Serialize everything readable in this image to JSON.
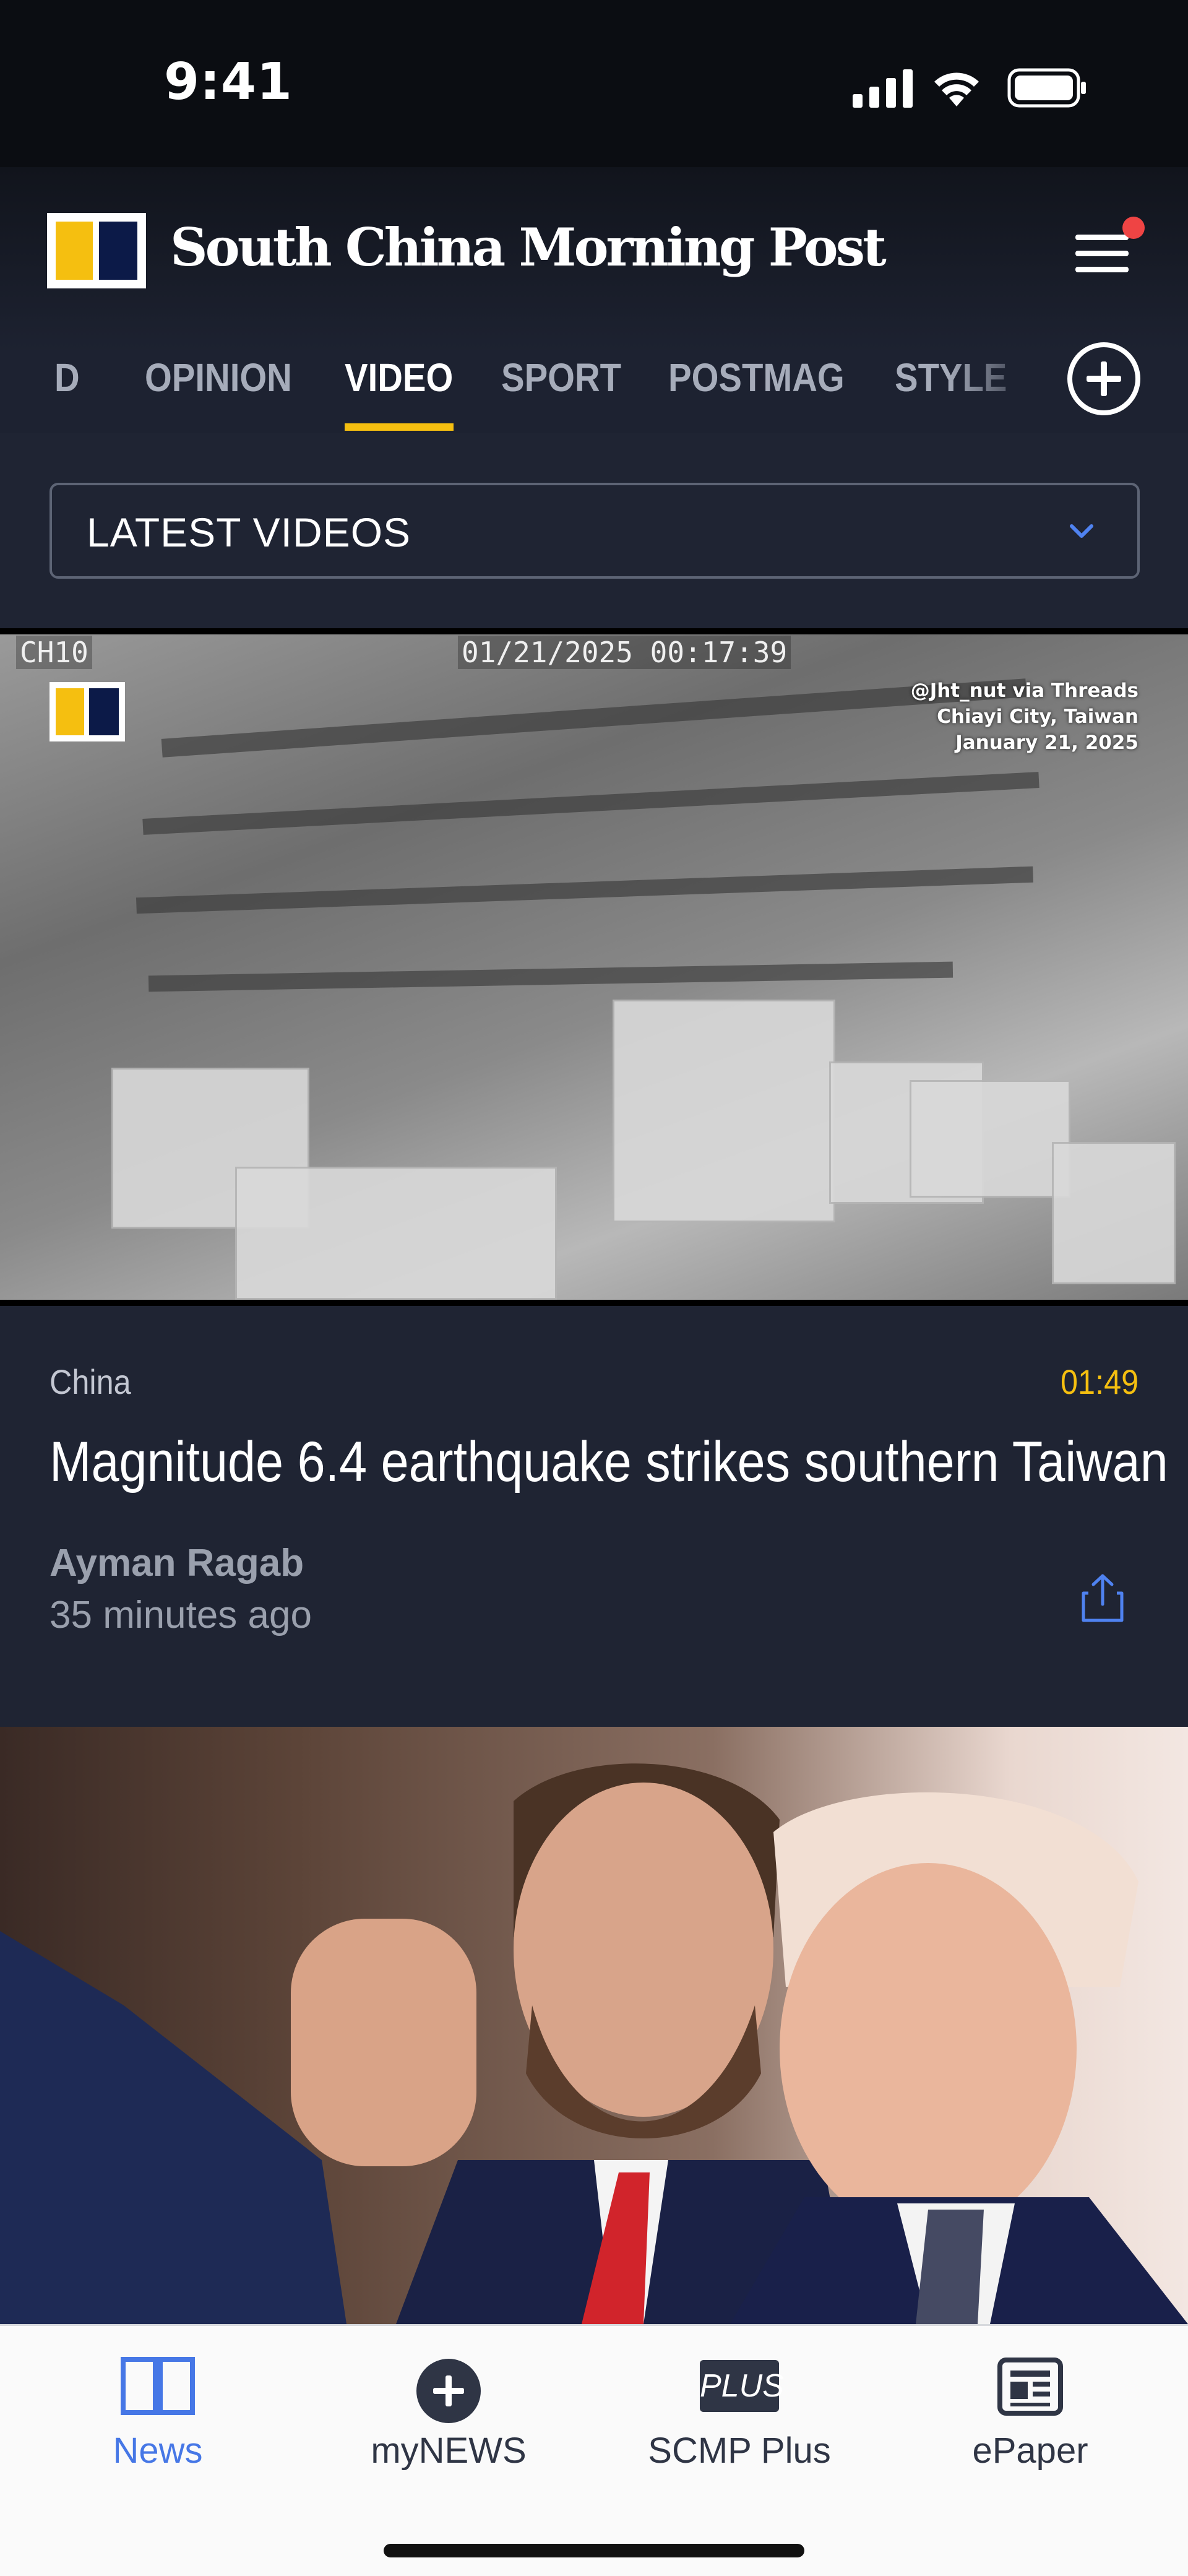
{
  "status_bar": {
    "time": "9:41"
  },
  "header": {
    "brand": "South China Morning Post"
  },
  "section_nav": {
    "items": [
      {
        "label": "D"
      },
      {
        "label": "OPINION"
      },
      {
        "label": "VIDEO"
      },
      {
        "label": "SPORT"
      },
      {
        "label": "POSTMAG"
      },
      {
        "label": "STYLE"
      }
    ],
    "active": "VIDEO"
  },
  "filter": {
    "selected": "LATEST VIDEOS"
  },
  "video_card": {
    "cctv_channel": "CH10",
    "cctv_timestamp": "01/21/2025 00:17:39",
    "credit_line1": "@Jht_nut via Threads",
    "credit_line2": "Chiayi City, Taiwan",
    "credit_line3": "January 21, 2025",
    "category": "China",
    "duration": "01:49",
    "title": "Magnitude 6.4 earthquake strikes southern Taiwan",
    "author": "Ayman Ragab",
    "time_ago": "35 minutes ago"
  },
  "tab_bar": {
    "items": [
      {
        "label": "News",
        "icon": "book-icon"
      },
      {
        "label": "myNEWS",
        "icon": "plus-circle-icon"
      },
      {
        "label": "SCMP Plus",
        "icon": "plus-badge-icon",
        "badge": "PLUS"
      },
      {
        "label": "ePaper",
        "icon": "newspaper-icon"
      }
    ],
    "active": "News"
  },
  "colors": {
    "accent": "#f5bf10",
    "link_blue": "#4677e6",
    "background": "#1f2433",
    "notification": "#ef4444"
  }
}
